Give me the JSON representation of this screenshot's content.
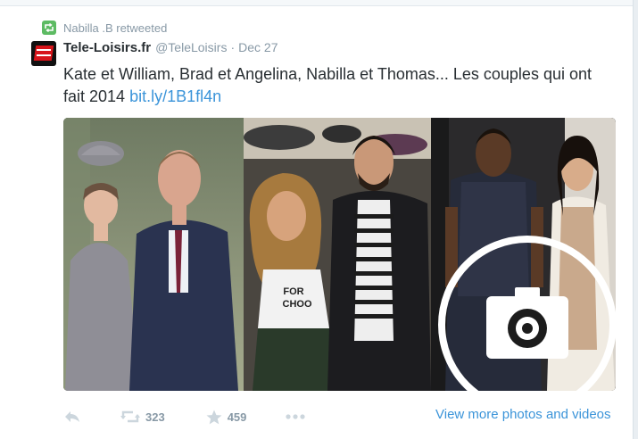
{
  "retweet": {
    "text": "Nabilla .B retweeted",
    "icon": "retweet-icon"
  },
  "tweet": {
    "author_name": "Tele-Loisirs.fr",
    "author_handle": "@TeleLoisirs",
    "separator": "·",
    "date": "Dec 27",
    "text": "Kate et William, Brad et Angelina, Nabilla et Thomas... Les couples qui ont fait 2014 ",
    "link": "bit.ly/1B1fl4n"
  },
  "media": {
    "photos": [
      "kate-william-photo",
      "nabilla-thomas-photo",
      "kanye-kim-photo"
    ],
    "overlay_icon": "camera-icon",
    "shirt_print": "FOR CHOO"
  },
  "actions": {
    "reply_icon": "reply-icon",
    "retweet_count": "323",
    "favorite_count": "459",
    "more_icon": "more-icon",
    "view_more": "View more photos and videos"
  },
  "colors": {
    "link": "#3b94d9",
    "muted": "#8899a6",
    "retweet_green": "#5dbb63",
    "text": "#292f33"
  }
}
